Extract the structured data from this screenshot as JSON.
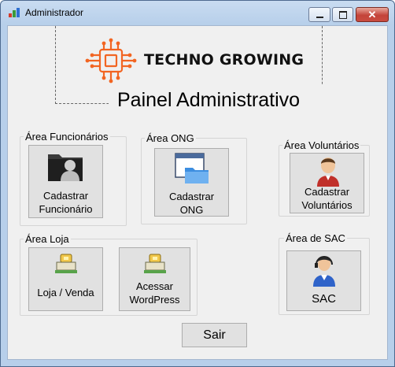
{
  "window": {
    "title": "Administrador"
  },
  "logo": {
    "text": "TECHNO GROWING"
  },
  "header": {
    "title": "Painel Administrativo"
  },
  "groups": {
    "funcionarios": {
      "label": "Área Funcionários",
      "button": "Cadastrar Funcionário"
    },
    "ong": {
      "label": "Área ONG",
      "button": "Cadastrar ONG"
    },
    "voluntarios": {
      "label": "Área Voluntários",
      "button": "Cadastrar Voluntários"
    },
    "loja": {
      "label": "Área Loja",
      "button_loja": "Loja / Venda",
      "button_wordpress": "Acessar WordPress"
    },
    "sac": {
      "label": "Área de SAC",
      "button": "SAC"
    }
  },
  "footer": {
    "exit_label": "Sair"
  },
  "colors": {
    "logo_accent": "#f26522",
    "titlebar": "#b7cfea"
  }
}
